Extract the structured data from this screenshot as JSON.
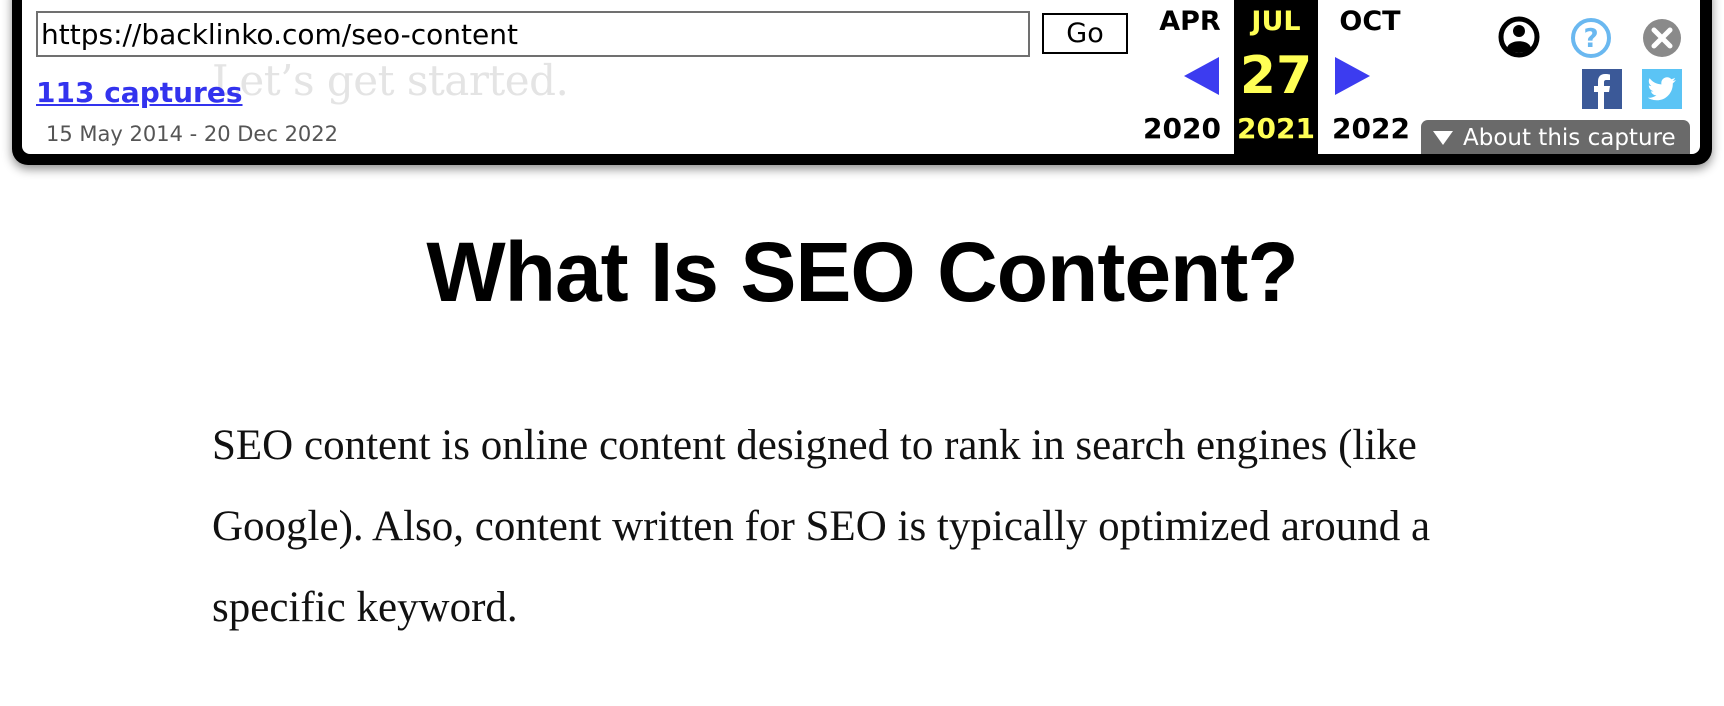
{
  "toolbar": {
    "url_value": "https://backlinko.com/seo-content",
    "go_label": "Go",
    "captures_label": "113 captures",
    "date_range": "15 May 2014 - 20 Dec 2022",
    "calendar": {
      "prev": {
        "month": "APR",
        "year": "2020"
      },
      "current": {
        "month": "JUL",
        "day": "27",
        "year": "2021"
      },
      "next": {
        "month": "OCT",
        "year": "2022"
      }
    },
    "about_label": "About this capture",
    "icons": {
      "account": "user-circle-icon",
      "help": "help-icon",
      "close": "close-icon",
      "facebook": "facebook-icon",
      "twitter": "twitter-icon",
      "prev": "arrow-left-icon",
      "next": "arrow-right-icon",
      "about": "triangle-down-icon"
    },
    "colors": {
      "current_highlight": "#ffff55",
      "arrow": "#3c3cf0",
      "link": "#3333ee",
      "help": "#6ab8f0",
      "close": "#8a8a8a",
      "facebook": "#3b5998",
      "twitter": "#5bc4f5"
    }
  },
  "page": {
    "ghost_text": "Let’s get started.",
    "heading": "What Is SEO Content?",
    "paragraph": "SEO content is online content designed to rank in search engines (like Google). Also, content written for SEO is typically optimized around a specific keyword."
  }
}
